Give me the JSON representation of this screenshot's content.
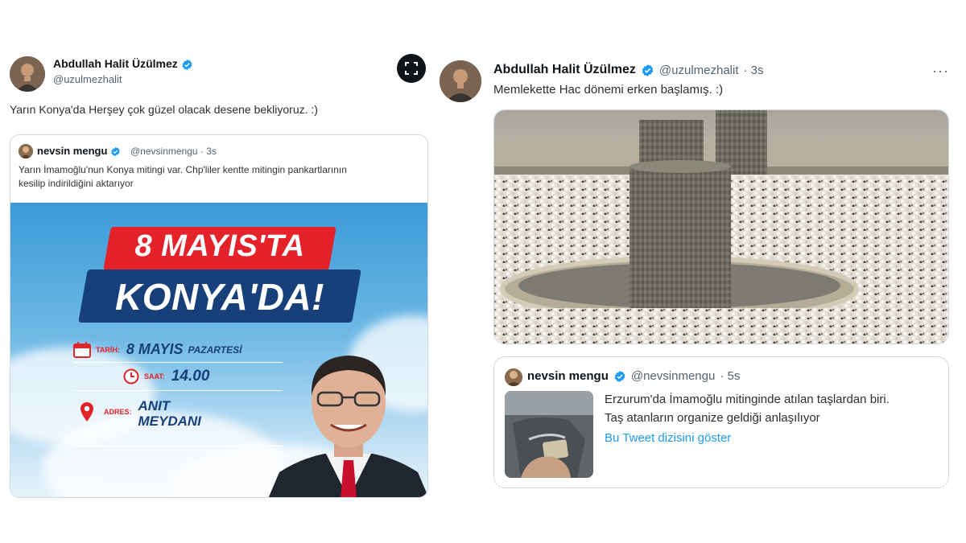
{
  "left_tweet": {
    "author_name": "Abdullah Halit Üzülmez",
    "author_handle": "@uzulmezhalit",
    "text": "Yarın Konya'da Herşey çok güzel olacak desene bekliyoruz.  :)",
    "expand_icon": "expand-icon",
    "quoted": {
      "author_name": "nevsin mengu",
      "author_handle": "@nevsinmengu",
      "time": "· 3s",
      "text_line1": "Yarın İmamoğlu'nun Konya mitingi var. Chp'liler kentte mitingin pankartlarının",
      "text_line2": "kesilip indirildiğini aktarıyor",
      "poster": {
        "banner_top": "8 MAYIS'TA",
        "banner_bottom": "KONYA'DA!",
        "date_label": "TARİH:",
        "date_value": "8 MAYIS",
        "date_day": "PAZARTESİ",
        "time_label": "SAAT:",
        "time_value": "14.00",
        "address_label": "ADRES:",
        "address_line1": "ANIT",
        "address_line2": "MEYDANI"
      }
    }
  },
  "right_tweet": {
    "author_name": "Abdullah Halit Üzülmez",
    "author_handle": "@uzulmezhalit",
    "time": "· 3s",
    "more_icon": "···",
    "text": "Memlekette Hac dönemi erken başlamış.  :)",
    "quoted": {
      "author_name": "nevsin mengu",
      "author_handle": "@nevsinmengu",
      "time": "· 5s",
      "text_line1": "Erzurum'da İmamoğlu mitinginde atılan taşlardan biri.",
      "text_line2": "Taş atanların organize geldiği anlaşılıyor",
      "link": "Bu Tweet dizisini göster"
    }
  },
  "colors": {
    "verified": "#1d9bf0",
    "banner_red": "#e4222a",
    "banner_blue": "#173f7a",
    "link": "#1d9bf0"
  }
}
